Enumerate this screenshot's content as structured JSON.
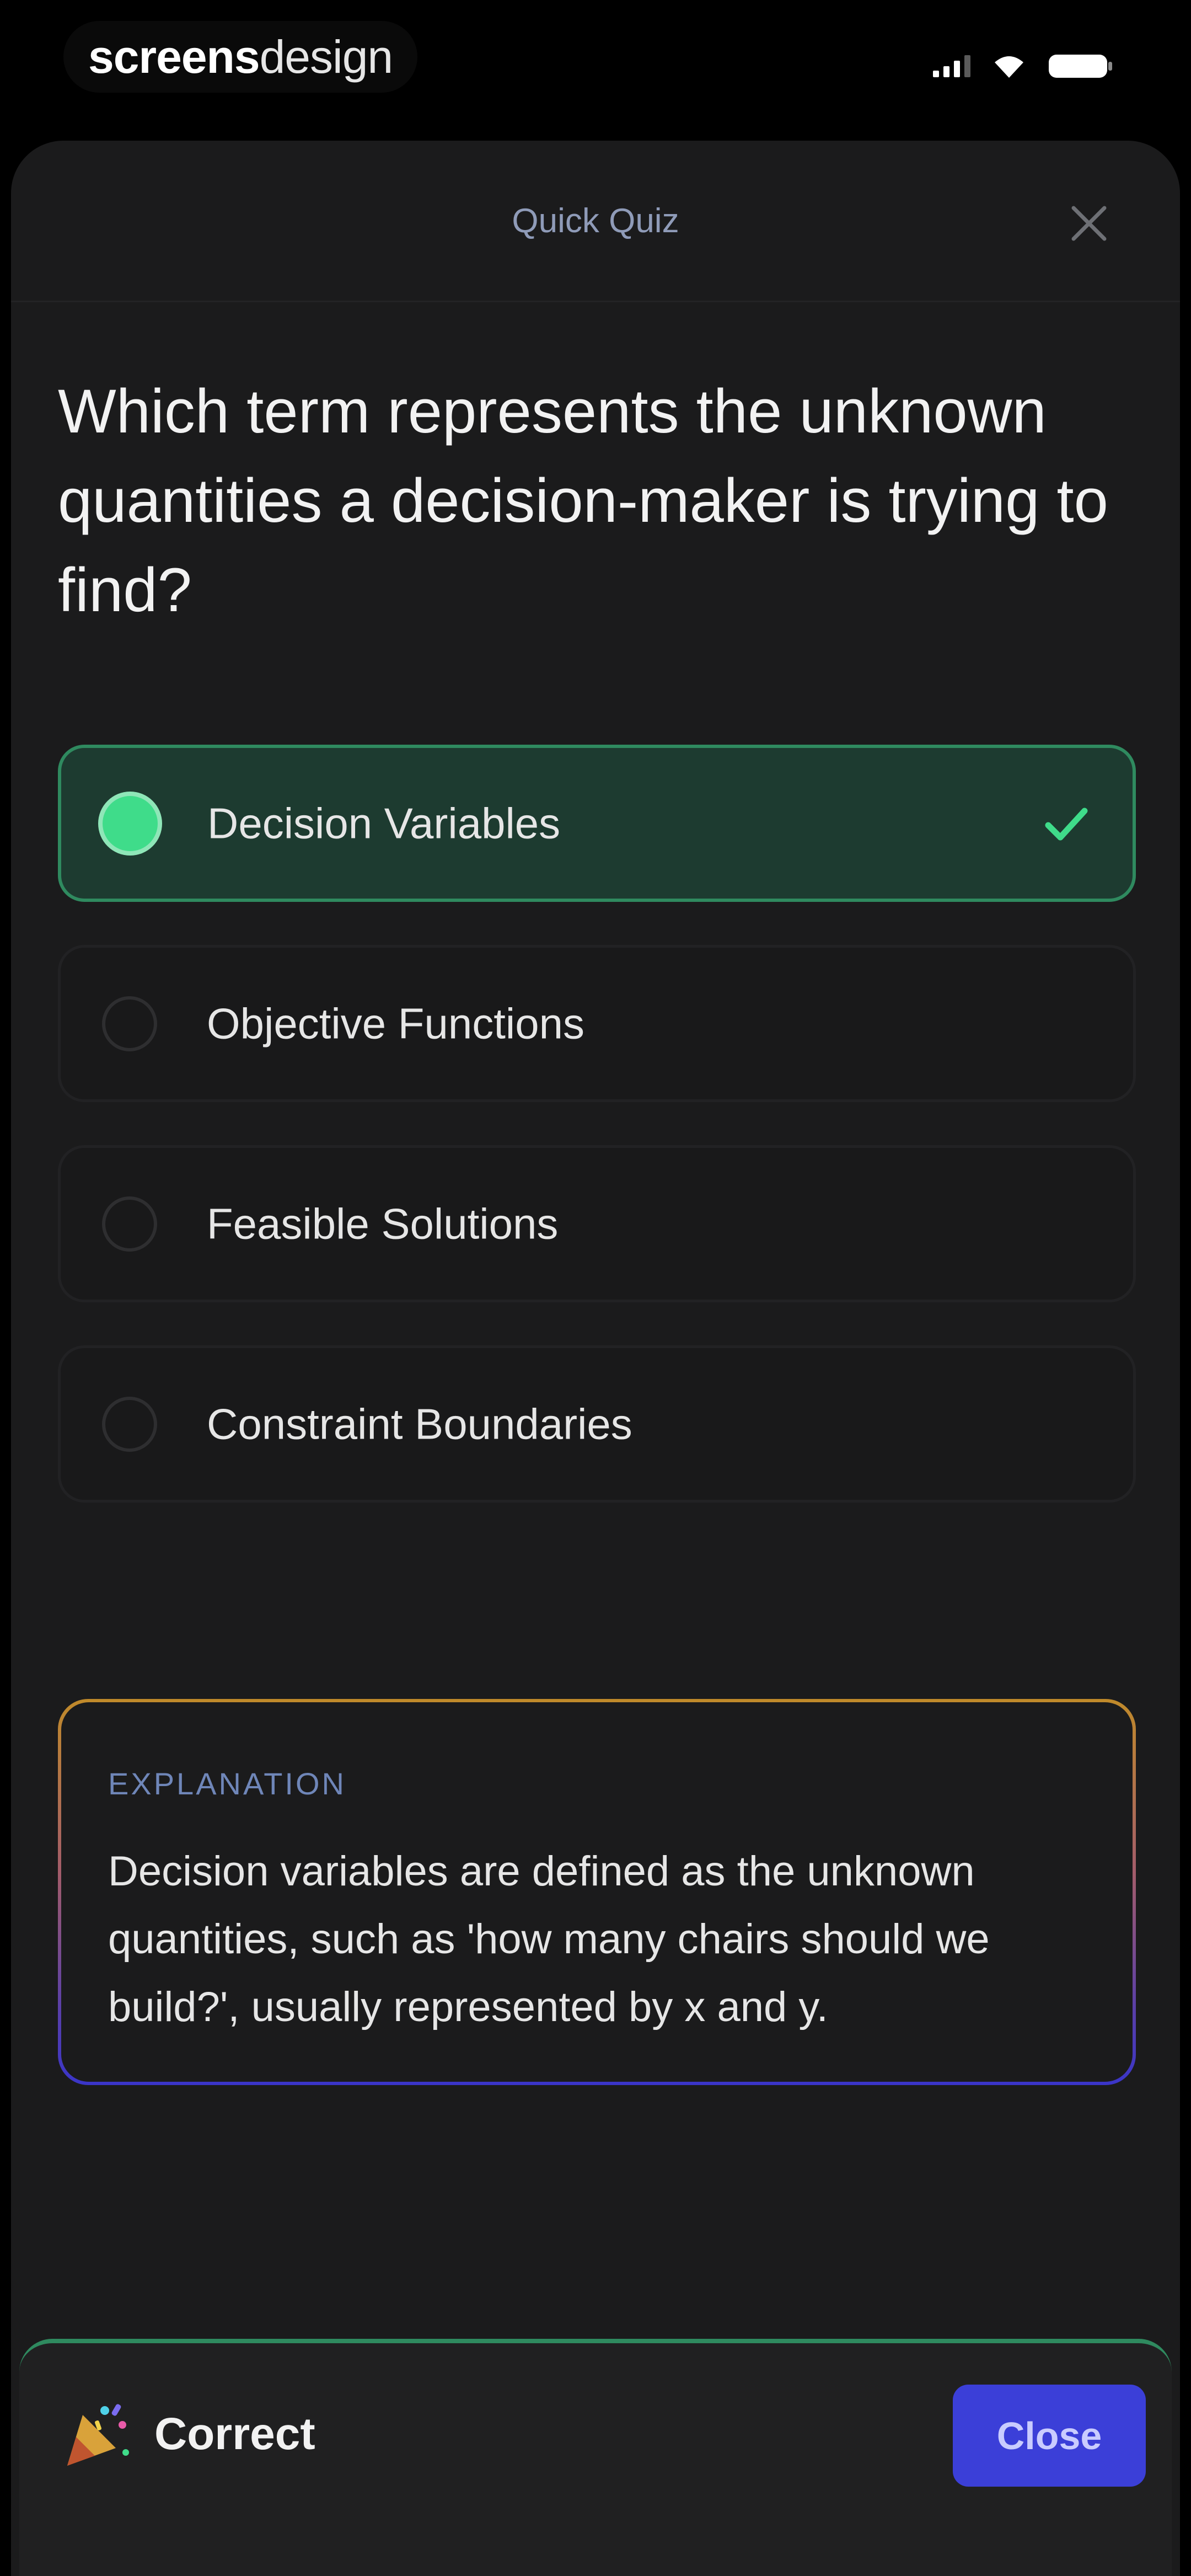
{
  "status_bar": {
    "brand_strong": "screens",
    "brand_light": "design",
    "signal_icon": "cellular-signal-icon",
    "wifi_icon": "wifi-icon",
    "battery_icon": "battery-icon"
  },
  "header": {
    "title": "Quick Quiz",
    "close_icon": "close-icon"
  },
  "question": {
    "text": "Which term represents the unknown quantities a decision-maker is trying to find?"
  },
  "options": [
    {
      "label": "Decision Variables",
      "selected": true,
      "correct": true
    },
    {
      "label": "Objective Functions",
      "selected": false
    },
    {
      "label": "Feasible Solutions",
      "selected": false
    },
    {
      "label": "Constraint Boundaries",
      "selected": false
    }
  ],
  "explanation": {
    "heading": "EXPLANATION",
    "text": "Decision variables are defined as the unknown quantities, such as 'how many chairs should we build?', usually represented by x and y."
  },
  "result": {
    "label": "Correct",
    "icon": "party-popper-icon",
    "button_label": "Close"
  },
  "colors": {
    "accent_green": "#3fdc8a",
    "selected_bg": "#1d3b30",
    "primary_button": "#3b3fd8",
    "title_color": "#8f9bb8"
  }
}
